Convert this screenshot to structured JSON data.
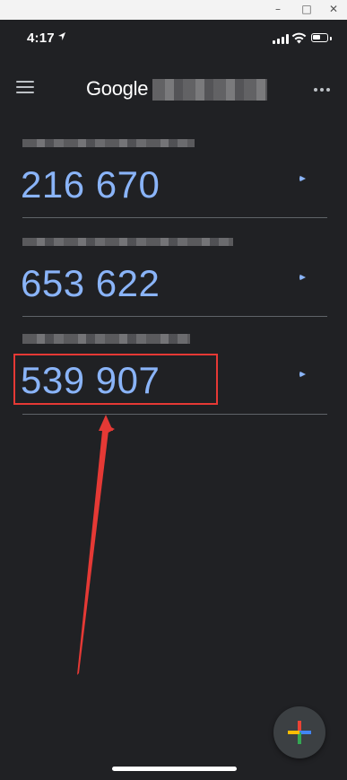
{
  "window_controls": {
    "minimize": "–",
    "maximize": "□",
    "close": "✕"
  },
  "status_bar": {
    "time": "4:17",
    "location_icon": "location-arrow-icon",
    "battery_level": 0.6
  },
  "app_bar": {
    "title": "Google",
    "menu_icon": "hamburger-menu-icon",
    "more_icon": "more-dots-icon"
  },
  "accounts": [
    {
      "code": "216 670",
      "timer_remaining": 0.15
    },
    {
      "code": "653 622",
      "timer_remaining": 0.15
    },
    {
      "code": "539 907",
      "timer_remaining": 0.15
    }
  ],
  "annotation": {
    "highlight_color": "#e53935",
    "target_account": 3
  },
  "fab": {
    "icon": "add-plus-icon",
    "colors": [
      "#ea4335",
      "#fbbc04",
      "#34a853",
      "#4285f4"
    ]
  },
  "colors": {
    "background": "#202124",
    "code": "#8ab4f8",
    "divider": "#5f6368"
  }
}
